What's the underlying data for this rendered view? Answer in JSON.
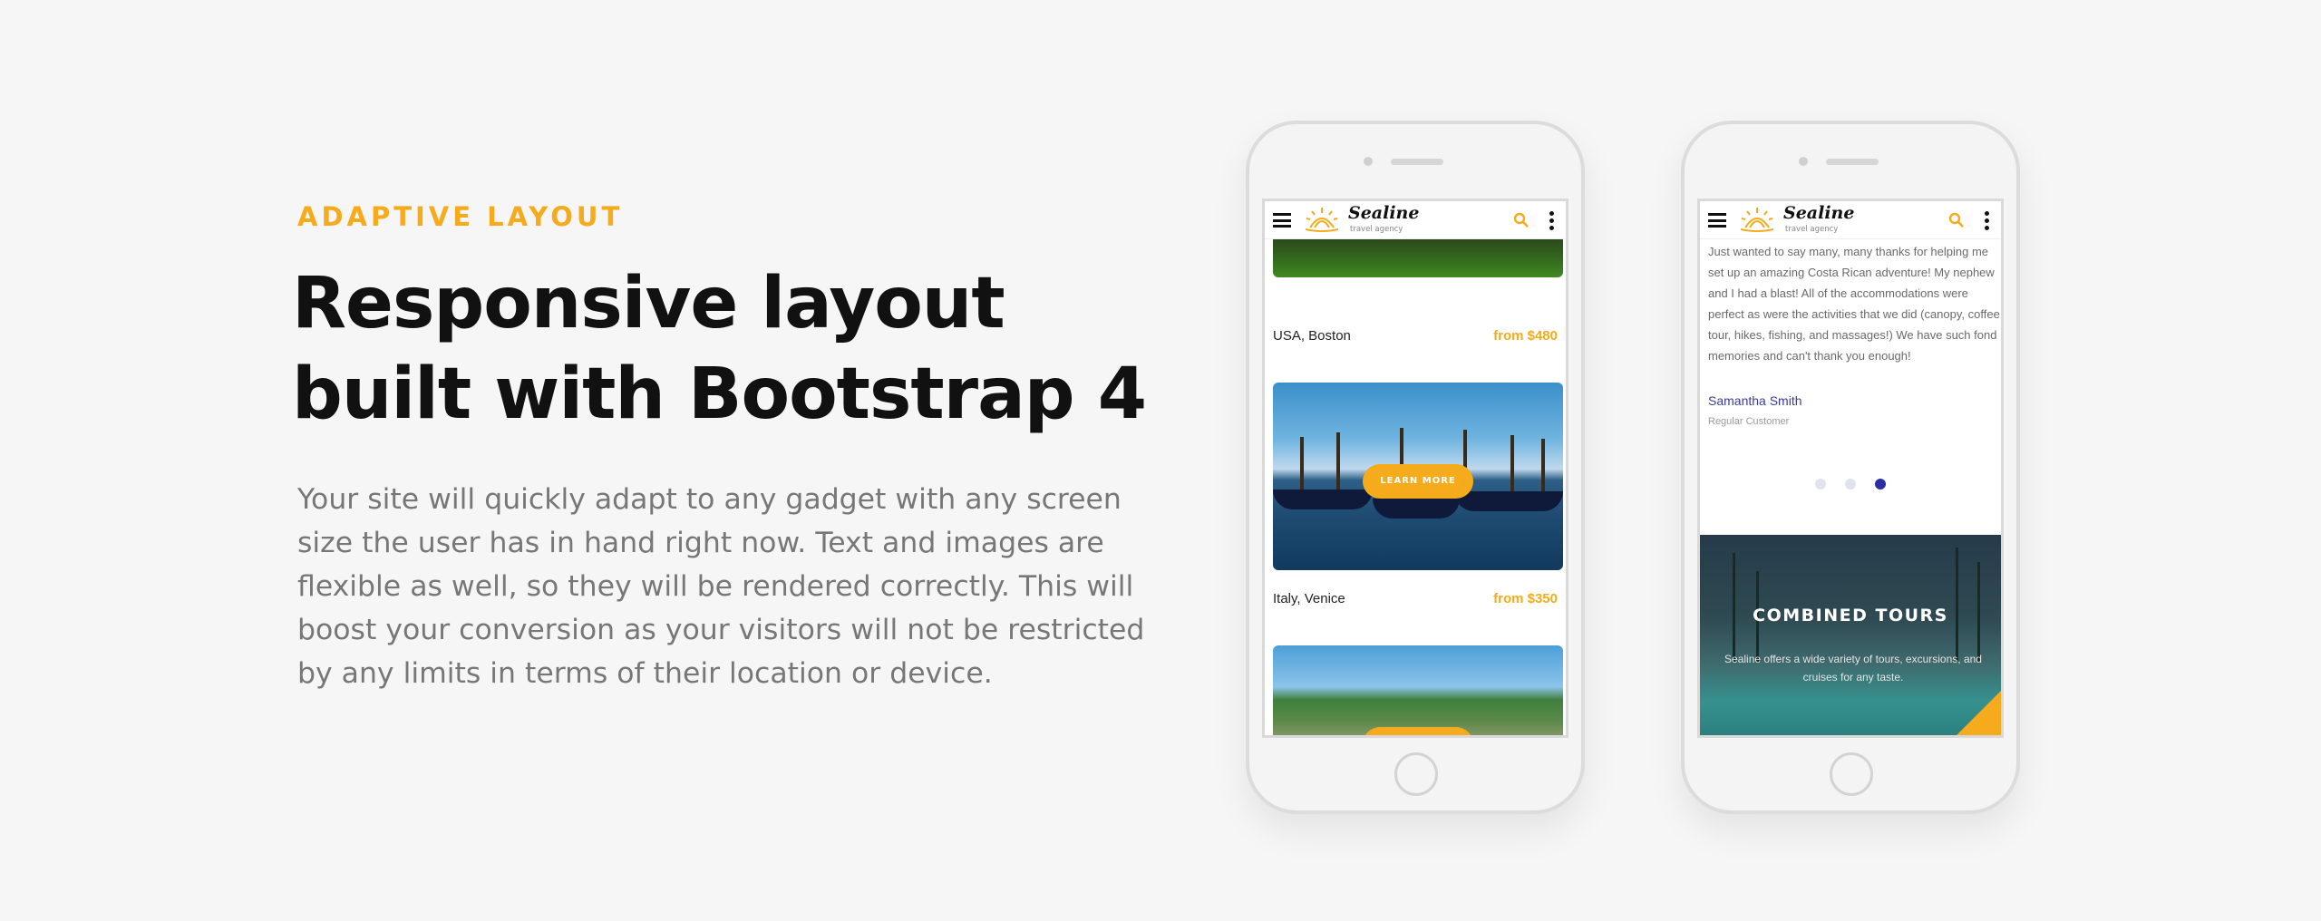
{
  "hero": {
    "eyebrow": "ADAPTIVE LAYOUT",
    "headline_line1": "Responsive layout",
    "headline_line2": "built with Bootstrap 4",
    "body": "Your site will quickly adapt to any gadget with any screen size the user has in hand right now. Text and images are flexible as well, so they will be rendered correctly. This will boost your conversion as your visitors will not be restricted by any limits in terms of their location or device."
  },
  "site": {
    "brand": "Sealine",
    "tagline": "travel agency",
    "accent_color": "#f5ab1b",
    "icons": [
      "hamburger-icon",
      "logo-mark",
      "search-icon",
      "more-vertical-icon"
    ]
  },
  "phone1": {
    "cards": [
      {
        "location": "USA, Boston",
        "price": "from $480"
      },
      {
        "location": "Italy, Venice",
        "price": "from $350",
        "button": "LEARN MORE"
      }
    ]
  },
  "phone2": {
    "testimonial": "Just wanted to say many, many thanks for helping me set up an amazing Costa Rican adventure! My nephew and I had a blast! All of the accommodations were perfect as were the activities that we did (canopy, coffee tour, hikes, fishing, and massages!) We have such fond memories and can't thank you enough!",
    "author": "Samantha Smith",
    "role": "Regular Customer",
    "carousel_active_index": 2,
    "carousel_count": 3,
    "tours_title": "COMBINED TOURS",
    "tours_text": "Sealine offers a wide variety of tours, excursions, and cruises for any taste."
  }
}
